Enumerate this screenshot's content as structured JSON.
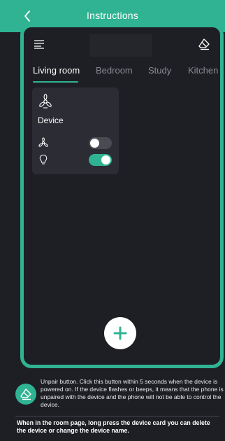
{
  "header": {
    "title": "Instructions"
  },
  "tabs": [
    {
      "label": "Living room"
    },
    {
      "label": "Bedroom"
    },
    {
      "label": "Study"
    },
    {
      "label": "Kitchen"
    }
  ],
  "device_card": {
    "name": "Device",
    "fan_switch": {
      "state": "off"
    },
    "light_switch": {
      "state": "on"
    }
  },
  "info": {
    "unpair_text": "Unpair button. Click this button within 5 seconds when the device is powered on. If the device flashes or beeps, it means that the phone is unpaired with the device and the phone will not be able to control the device."
  },
  "footer": {
    "text": "When in the room page, long press the device card you can delete the device or change the device name."
  },
  "colors": {
    "accent": "#2fb392",
    "background": "#1e1f24",
    "card": "#2c2d34"
  },
  "icons": {
    "back": "chevron-left-icon",
    "menu": "menu-icon",
    "erase": "eraser-icon",
    "fan": "fan-icon",
    "light": "bulb-icon",
    "add": "plus-icon"
  }
}
